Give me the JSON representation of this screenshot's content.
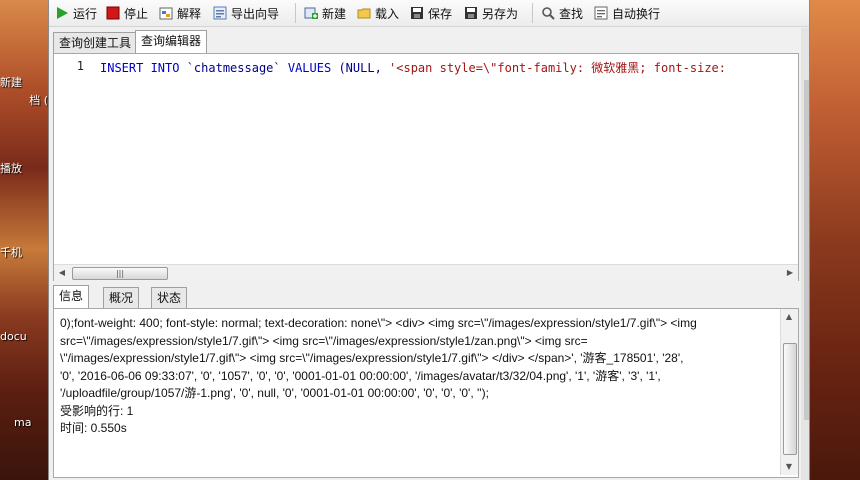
{
  "desktop": {
    "labels": [
      "新建",
      "档 (",
      "播放",
      "千机",
      "docu",
      "ma"
    ]
  },
  "toolbar": {
    "run": "运行",
    "stop": "停止",
    "explain": "解释",
    "export_wizard": "导出向导",
    "new": "新建",
    "load": "载入",
    "save": "保存",
    "save_as": "另存为",
    "find": "查找",
    "word_wrap": "自动换行"
  },
  "tabs": {
    "query_builder": "查询创建工具",
    "query_editor": "查询编辑器"
  },
  "editor": {
    "line_number": "1",
    "code_keyword_1": "INSERT INTO",
    "code_table": " `chatmessage` ",
    "code_keyword_2": "VALUES",
    "code_open": " (NULL, ",
    "code_string": "'<span style=\\\"font-family: 微软雅黑; font-size:"
  },
  "result_tabs": {
    "info": "信息",
    "overview": "概况",
    "status": "状态"
  },
  "messages": {
    "lines": [
      "0);font-weight: 400; font-style: normal; text-decoration: none\\\"> <div> <img src=\\\"/images/expression/style1/7.gif\\\"> <img",
      "src=\\\"/images/expression/style1/7.gif\\\"> <img src=\\\"/images/expression/style1/zan.png\\\"> <img src=",
      "\\\"/images/expression/style1/7.gif\\\"> <img src=\\\"/images/expression/style1/7.gif\\\"> </div> </span>', '游客_178501', '28',",
      "'0', '2016-06-06 09:33:07', '0', '1057', '0', '0', '0001-01-01 00:00:00', '/images/avatar/t3/32/04.png', '1', '游客', '3', '1',",
      "'/uploadfile/group/1057/游-1.png', '0', null, '0', '0001-01-01 00:00:00', '0', '0', '0', '');",
      "受影响的行: 1",
      "时间: 0.550s"
    ]
  },
  "colors": {
    "keyword": "#0000cc",
    "string": "#a31515"
  }
}
